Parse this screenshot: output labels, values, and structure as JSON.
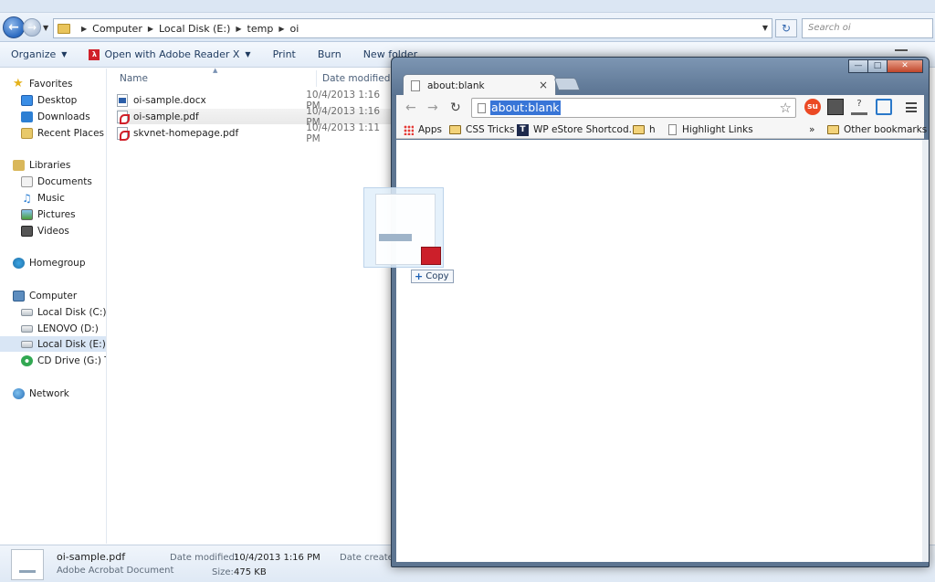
{
  "explorer": {
    "breadcrumb": [
      "Computer",
      "Local Disk (E:)",
      "temp",
      "oi"
    ],
    "search_placeholder": "Search oi",
    "toolbar": {
      "organize": "Organize",
      "open_with": "Open with Adobe Reader X",
      "print": "Print",
      "burn": "Burn",
      "new_folder": "New folder"
    },
    "nav": {
      "favorites": "Favorites",
      "desktop": "Desktop",
      "downloads": "Downloads",
      "recent": "Recent Places",
      "libraries": "Libraries",
      "documents": "Documents",
      "music": "Music",
      "pictures": "Pictures",
      "videos": "Videos",
      "homegroup": "Homegroup",
      "computer": "Computer",
      "disk_c": "Local Disk (C:)",
      "lenovo": "LENOVO (D:)",
      "disk_e": "Local Disk (E:)",
      "cd": "CD Drive (G:) Tat",
      "network": "Network"
    },
    "columns": {
      "name": "Name",
      "date": "Date modified"
    },
    "files": [
      {
        "name": "oi-sample.docx",
        "date": "10/4/2013 1:16 PM",
        "icon": "word-doc-icon"
      },
      {
        "name": "oi-sample.pdf",
        "date": "10/4/2013 1:16 PM",
        "icon": "pdf-file-icon"
      },
      {
        "name": "skvnet-homepage.pdf",
        "date": "10/4/2013 1:11 PM",
        "icon": "pdf-file-icon"
      }
    ],
    "drag": {
      "copy_label": "Copy"
    },
    "details": {
      "name": "oi-sample.pdf",
      "type": "Adobe Acrobat Document",
      "date_modified_label": "Date modified:",
      "date_modified": "10/4/2013 1:16 PM",
      "date_created_label": "Date created",
      "size_label": "Size:",
      "size": "475 KB"
    }
  },
  "chrome": {
    "tab_title": "about:blank",
    "tab_close": "×",
    "url": "about:blank",
    "bookmarks": {
      "apps": "Apps",
      "css_tricks": "CSS Tricks",
      "wp_estore": "WP eStore Shortcod...",
      "h": "h",
      "highlight": "Highlight Links",
      "chevron": "»",
      "other": "Other bookmarks"
    }
  },
  "colors": {
    "selection": "#3875d7",
    "chrome_frame": "#5d7591",
    "explorer_selected_nav": "#d9e6f5"
  }
}
